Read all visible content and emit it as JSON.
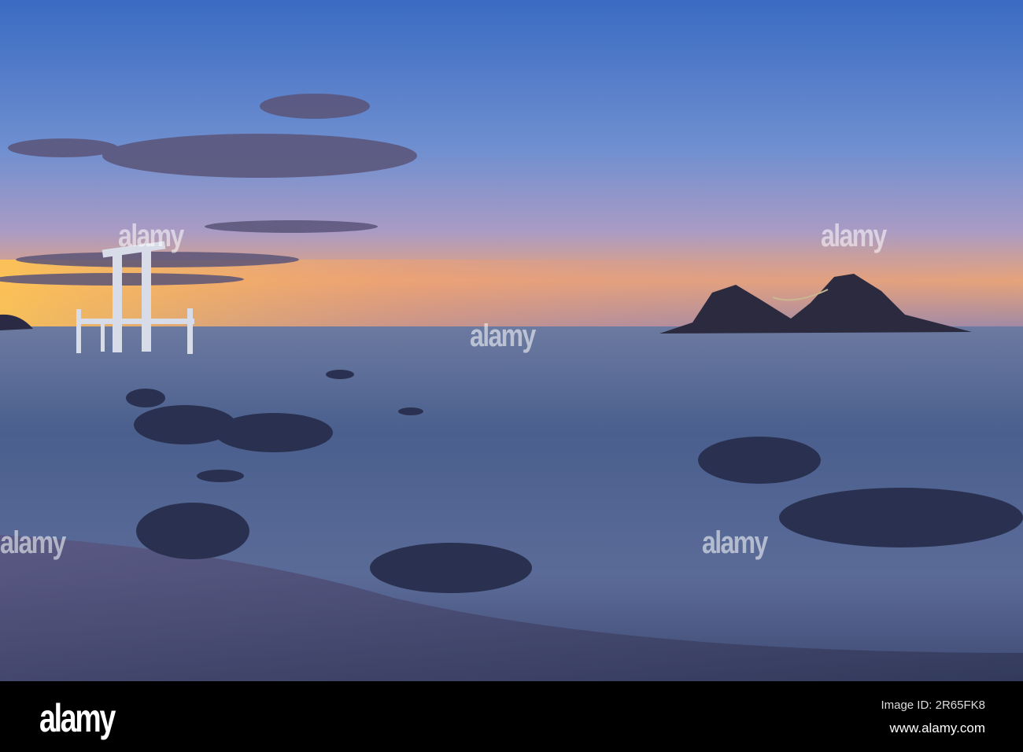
{
  "watermark": "alamy",
  "footer": {
    "logo": "alamy",
    "image_id": "Image ID: 2R65FK8",
    "url": "www.alamy.com"
  },
  "colors": {
    "sky_top": "#3f6fc4",
    "horizon": "#f4b860",
    "sea": "#4a5f8a",
    "footer": "#000000"
  }
}
